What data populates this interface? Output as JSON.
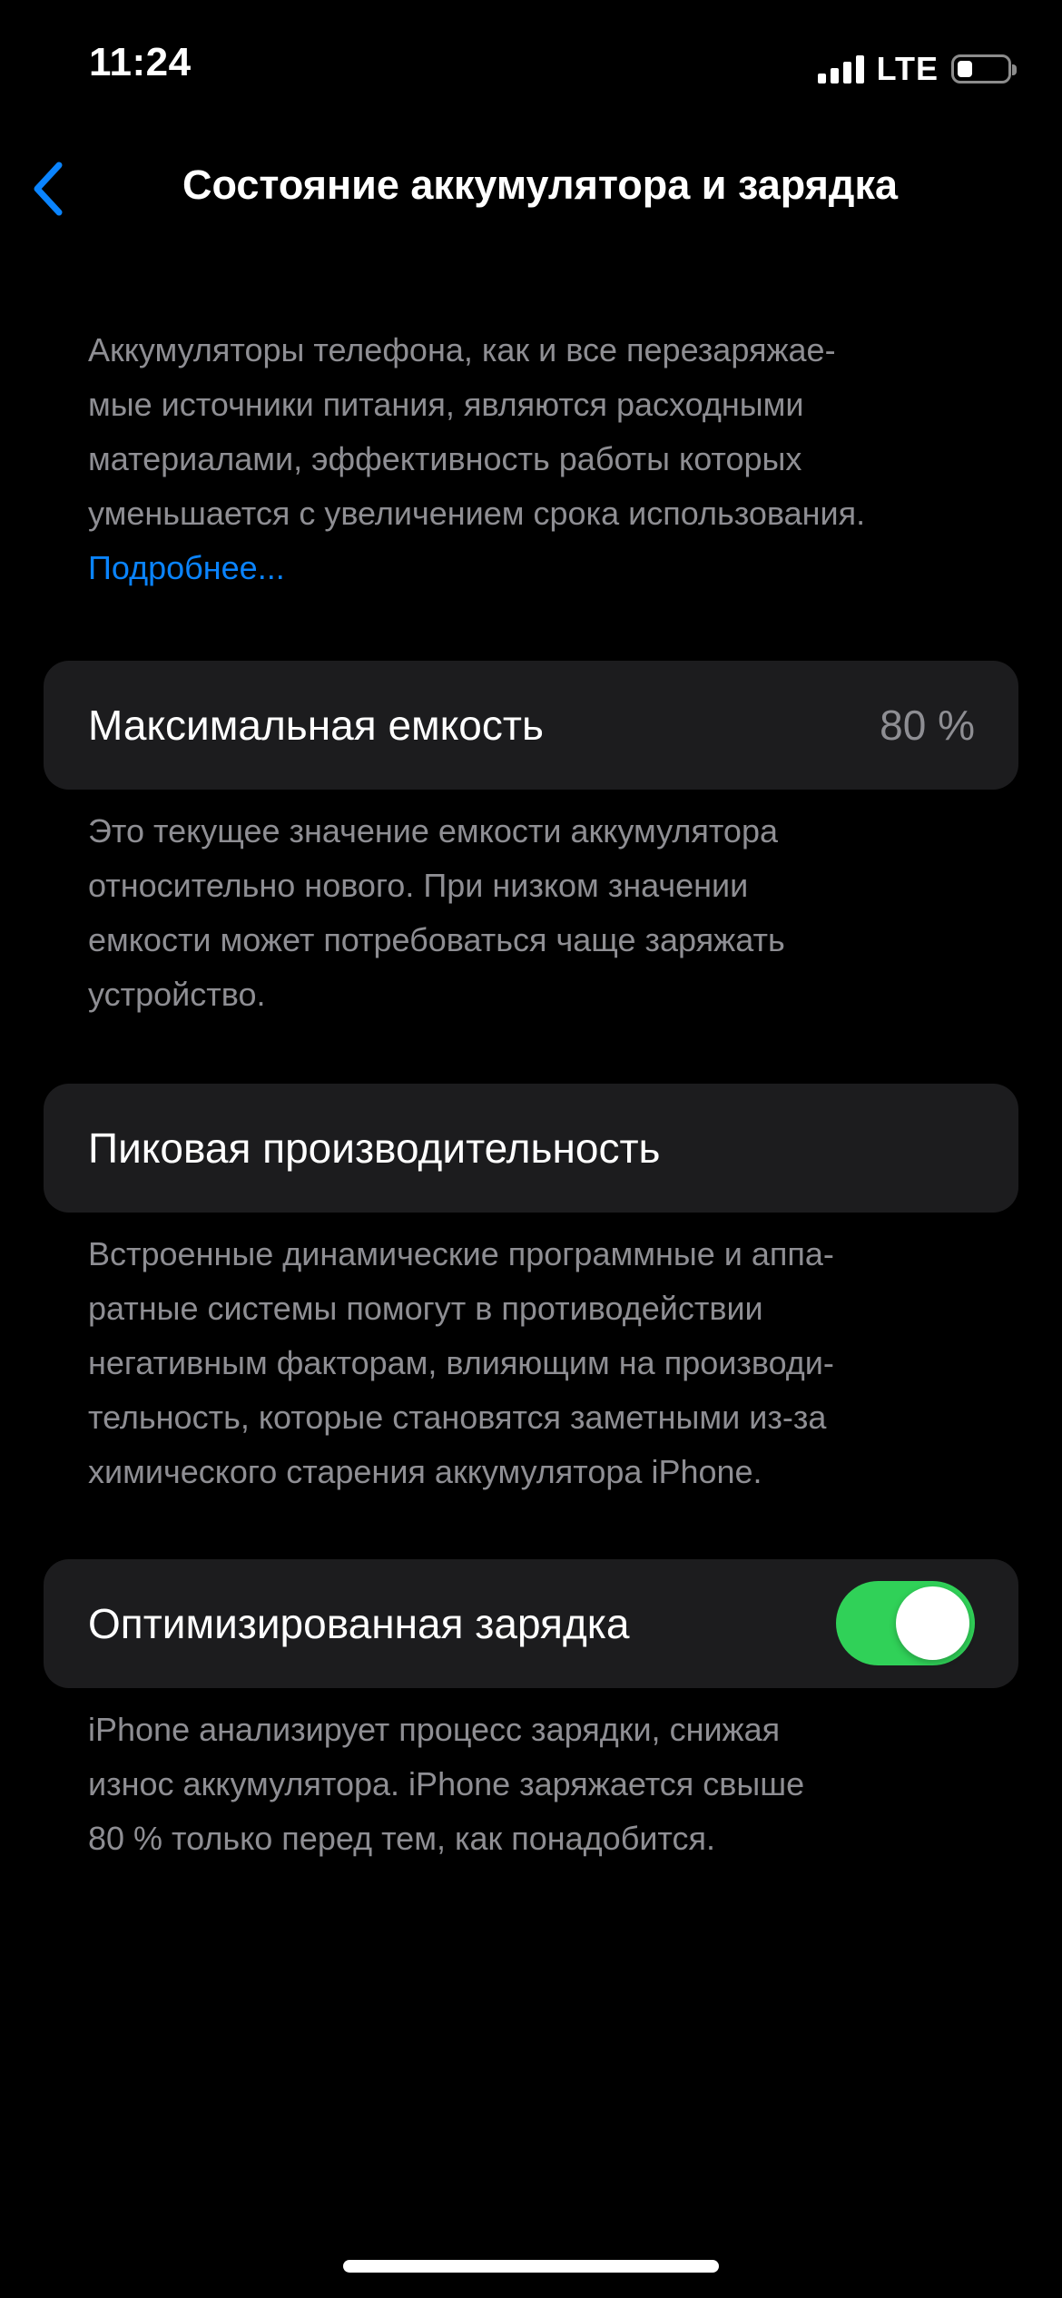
{
  "status_bar": {
    "time": "11:24",
    "network": "LTE",
    "icons": [
      "cellular-signal-icon",
      "battery-icon"
    ],
    "battery_level": 0.3
  },
  "nav": {
    "back_icon": "chevron-left-icon",
    "title": "Состояние аккумулятора и зарядка"
  },
  "intro": {
    "lines": [
      "Аккумуляторы телефона, как и все перезаряжае-",
      "мые источники питания, являются расходными",
      "материалами, эффективность работы которых",
      "уменьшается с увеличением срока использования."
    ],
    "link": "Подробнее..."
  },
  "max_capacity": {
    "label": "Максимальная емкость",
    "value": "80 %",
    "description_lines": [
      "Это текущее значение емкости аккумулятора",
      "относительно нового. При низком значении",
      "емкости может потребоваться чаще заряжать",
      "устройство."
    ]
  },
  "peak_performance": {
    "label": "Пиковая производительность",
    "description_lines": [
      "Встроенные динамические программные и аппа-",
      "ратные системы помогут в противодействии",
      "негативным факторам, влияющим на производи-",
      "тельность, которые становятся заметными из-за",
      "химического старения аккумулятора iPhone."
    ]
  },
  "optimized_charging": {
    "label": "Оптимизированная зарядка",
    "enabled": true,
    "description_lines": [
      "iPhone анализирует процесс зарядки, снижая",
      "износ аккумулятора. iPhone заряжается свыше",
      "80 % только перед тем, как понадобится."
    ]
  },
  "colors": {
    "background": "#000000",
    "card": "#1c1c1e",
    "secondary_text": "#8e8e93",
    "link": "#0a84ff",
    "toggle_on": "#30d158"
  }
}
